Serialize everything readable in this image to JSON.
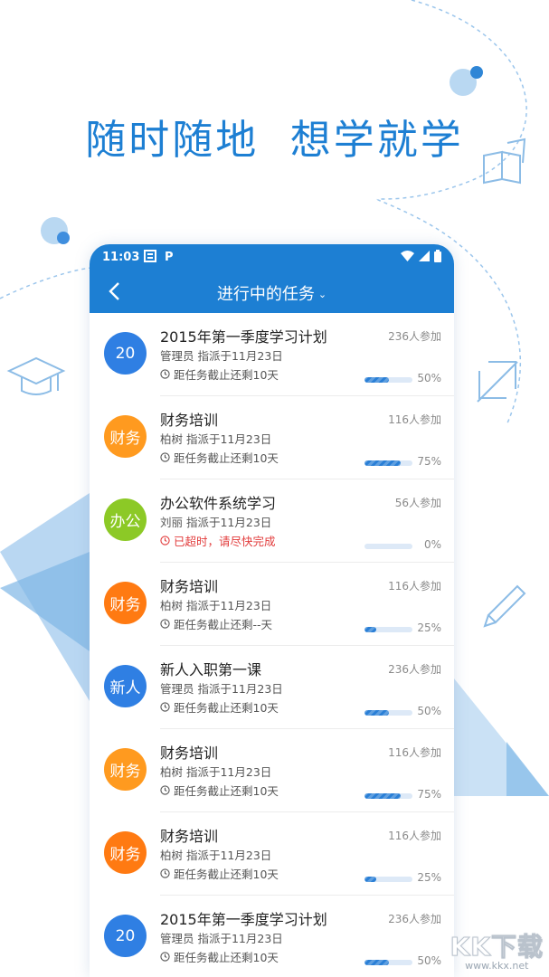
{
  "slogan": "随时随地  想学就学",
  "status_bar": {
    "time": "11:03"
  },
  "nav": {
    "title": "进行中的任务",
    "arrow": "⌄"
  },
  "colors": {
    "primary": "#1d7fd3",
    "blue": "#2f7fe3",
    "orange": "#ff7a12",
    "amber": "#ff9a1f",
    "green": "#8cc926",
    "overdue": "#e23b3b"
  },
  "tasks": [
    {
      "avatar": "20",
      "avatar_color": "#2f7fe3",
      "title": "2015年第一季度学习计划",
      "assign": "管理员  指派于11月23日",
      "deadline": "距任务截止还剩10天",
      "overdue": false,
      "participants": "236人参加",
      "progress": 0.5,
      "percent": "50%"
    },
    {
      "avatar": "财务",
      "avatar_color": "#ff9a1f",
      "title": "财务培训",
      "assign": "柏树  指派于11月23日",
      "deadline": "距任务截止还剩10天",
      "overdue": false,
      "participants": "116人参加",
      "progress": 0.75,
      "percent": "75%"
    },
    {
      "avatar": "办公",
      "avatar_color": "#8cc926",
      "title": "办公软件系统学习",
      "assign": "刘丽  指派于11月23日",
      "deadline": "已超时，请尽快完成",
      "overdue": true,
      "participants": "56人参加",
      "progress": 0,
      "percent": "0%"
    },
    {
      "avatar": "财务",
      "avatar_color": "#ff7a12",
      "title": "财务培训",
      "assign": "柏树  指派于11月23日",
      "deadline": "距任务截止还剩--天",
      "overdue": false,
      "participants": "116人参加",
      "progress": 0.25,
      "percent": "25%"
    },
    {
      "avatar": "新人",
      "avatar_color": "#2f7fe3",
      "title": "新人入职第一课",
      "assign": "管理员  指派于11月23日",
      "deadline": "距任务截止还剩10天",
      "overdue": false,
      "participants": "236人参加",
      "progress": 0.5,
      "percent": "50%"
    },
    {
      "avatar": "财务",
      "avatar_color": "#ff9a1f",
      "title": "财务培训",
      "assign": "柏树  指派于11月23日",
      "deadline": "距任务截止还剩10天",
      "overdue": false,
      "participants": "116人参加",
      "progress": 0.75,
      "percent": "75%"
    },
    {
      "avatar": "财务",
      "avatar_color": "#ff7a12",
      "title": "财务培训",
      "assign": "柏树  指派于11月23日",
      "deadline": "距任务截止还剩10天",
      "overdue": false,
      "participants": "116人参加",
      "progress": 0.25,
      "percent": "25%"
    },
    {
      "avatar": "20",
      "avatar_color": "#2f7fe3",
      "title": "2015年第一季度学习计划",
      "assign": "管理员  指派于11月23日",
      "deadline": "距任务截止还剩10天",
      "overdue": false,
      "participants": "236人参加",
      "progress": 0.5,
      "percent": "50%"
    }
  ],
  "watermark": {
    "big": "KK下载",
    "small": "www.kkx.net"
  }
}
